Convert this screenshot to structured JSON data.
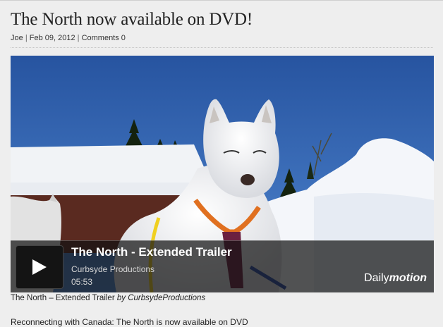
{
  "post": {
    "title": "The North now available on DVD!",
    "author": "Joe",
    "date": "Feb 09, 2012",
    "comments": "Comments 0",
    "separator": "|"
  },
  "video": {
    "title": "The North - Extended Trailer",
    "channel": "Curbsyde Productions",
    "duration": "05:53",
    "brand_prefix": "Daily",
    "brand_suffix": "motion",
    "play_icon": "play-icon"
  },
  "caption": {
    "text": "The North – Extended Trailer",
    "by": "by CurbsydeProductions"
  },
  "body": {
    "first_line": "Reconnecting with Canada: The North is now available on DVD"
  }
}
